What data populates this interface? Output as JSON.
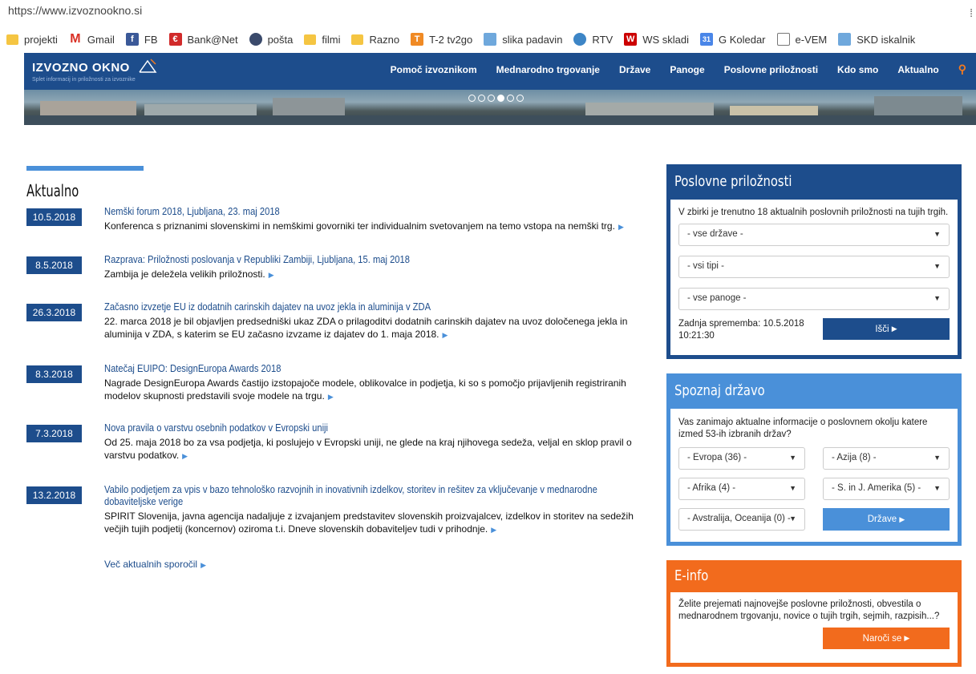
{
  "browser": {
    "url": "https://www.izvoznookno.si",
    "bookmarks": [
      {
        "label": "projekti",
        "icon": "folder-icon"
      },
      {
        "label": "Gmail",
        "icon": "gmail-icon"
      },
      {
        "label": "FB",
        "icon": "facebook-icon"
      },
      {
        "label": "Bank@Net",
        "icon": "bank-icon"
      },
      {
        "label": "pošta",
        "icon": "mail-icon"
      },
      {
        "label": "filmi",
        "icon": "folder-icon"
      },
      {
        "label": "Razno",
        "icon": "folder-icon"
      },
      {
        "label": "T-2 tv2go",
        "icon": "tv-icon"
      },
      {
        "label": "slika padavin",
        "icon": "weather-icon"
      },
      {
        "label": "RTV",
        "icon": "rtv-icon"
      },
      {
        "label": "WS skladi",
        "icon": "ws-icon"
      },
      {
        "label": "G Koledar",
        "icon": "calendar-icon"
      },
      {
        "label": "e-VEM",
        "icon": "document-icon"
      },
      {
        "label": "SKD iskalnik",
        "icon": "search-doc-icon"
      }
    ]
  },
  "site": {
    "logo": "IZVOZNO OKNO",
    "logo_sub": "Splet informacij in priložnosti za izvoznike",
    "nav": [
      "Pomoč izvoznikom",
      "Mednarodno trgovanje",
      "Države",
      "Panoge",
      "Poslovne priložnosti",
      "Kdo smo",
      "Aktualno"
    ]
  },
  "news": {
    "title": "Aktualno",
    "items": [
      {
        "date": "10.5.2018",
        "title": "Nemški forum 2018, Ljubljana, 23. maj 2018",
        "text": "Konferenca s priznanimi slovenskimi in nemškimi govorniki ter individualnim svetovanjem na temo vstopa na nemški trg."
      },
      {
        "date": "8.5.2018",
        "title": "Razprava: Priložnosti poslovanja v Republiki Zambiji, Ljubljana, 15. maj 2018",
        "text": "Zambija je deležela velikih priložnosti."
      },
      {
        "date": "26.3.2018",
        "title": "Začasno izvzetje EU iz dodatnih carinskih dajatev na uvoz jekla in aluminija v ZDA",
        "text": "22. marca 2018 je bil objavljen predsedniški ukaz ZDA o prilagoditvi dodatnih carinskih dajatev na uvoz določenega jekla in aluminija v ZDA, s katerim se EU začasno izvzame iz dajatev do 1. maja 2018."
      },
      {
        "date": "8.3.2018",
        "title": "Natečaj EUIPO: DesignEuropa Awards 2018",
        "text": "Nagrade DesignEuropa Awards častijo izstopajoče modele, oblikovalce in podjetja, ki so s pomočjo prijavljenih registriranih modelov skupnosti predstavili svoje modele na trgu."
      },
      {
        "date": "7.3.2018",
        "title": "Nova pravila o varstvu osebnih podatkov v Evropski uniji",
        "text": "Od 25. maja 2018 bo za vsa podjetja, ki poslujejo v Evropski uniji, ne glede na kraj njihovega sedeža, veljal en sklop pravil o varstvu podatkov."
      },
      {
        "date": "13.2.2018",
        "title": "Vabilo podjetjem za vpis v bazo tehnološko razvojnih in inovativnih izdelkov, storitev in rešitev za vključevanje v mednarodne dobaviteljske verige",
        "text": "SPIRIT Slovenija, javna agencija nadaljuje z izvajanjem predstavitev slovenskih proizvajalcev, izdelkov in storitev na sedežih večjih tujih podjetij (koncernov) oziroma t.i. Dneve slovenskih dobaviteljev tudi v prihodnje."
      }
    ],
    "more": "Več aktualnih sporočil"
  },
  "opportunities": {
    "title": "Poslovne priložnosti",
    "intro": "V zbirki je trenutno 18 aktualnih poslovnih priložnosti na tujih trgih.",
    "select_country": "- vse države -",
    "select_type": "- vsi tipi -",
    "select_sector": "- vse panoge -",
    "last_change": "Zadnja sprememba: 10.5.2018 10:21:30",
    "search_button": "Išči"
  },
  "countries": {
    "title": "Spoznaj državo",
    "intro": "Vas zanimajo aktualne informacije o poslovnem okolju katere izmed 53-ih izbranih držav?",
    "europe": "- Evropa (36) -",
    "asia": "- Azija (8) -",
    "africa": "- Afrika (4) -",
    "america": "- S. in J. Amerika (5) -",
    "oceania": "- Avstralija, Oceanija (0) -",
    "button": "Države"
  },
  "einfo": {
    "title": "E-info",
    "text": "Želite prejemati najnovejše poslovne priložnosti, obvestila o mednarodnem trgovanju, novice o tujih trgih, sejmih, razpisih...?",
    "button": "Naroči se"
  }
}
